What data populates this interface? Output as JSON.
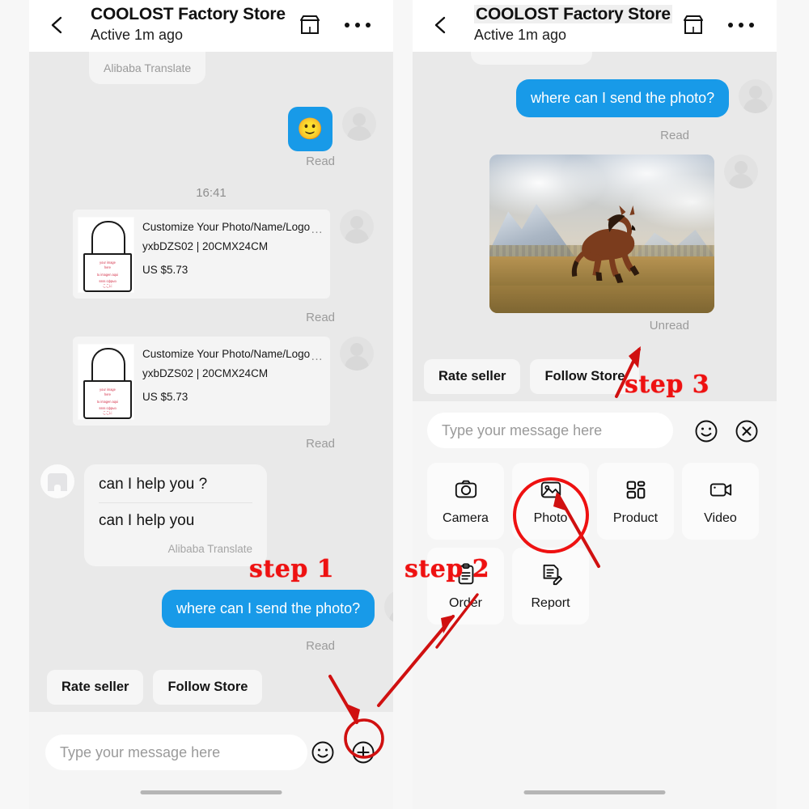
{
  "header": {
    "title": "COOLOST Factory Store",
    "subtitle": "Active 1m ago",
    "back_icon": "chevron-left-icon",
    "store_icon": "storefront-icon",
    "more_icon": "more-options-icon"
  },
  "left_panel": {
    "translate_chip": "Alibaba Translate",
    "emoji_message": "🙂",
    "emoji_status": "Read",
    "timestamp": "16:41",
    "product_cards": [
      {
        "title": "Customize Your Photo/Name/Logo",
        "variant": "yxbDZS02 | 20CMX24CM",
        "price": "US $5.73",
        "more": "…",
        "status": "Read",
        "bag_text_lines": [
          "your image",
          "here",
          "tu imagen aqui",
          "ssss сфрыз",
          "ここに"
        ]
      },
      {
        "title": "Customize Your Photo/Name/Logo",
        "variant": "yxbDZS02 | 20CMX24CM",
        "price": "US $5.73",
        "more": "…",
        "status": "Read",
        "bag_text_lines": [
          "your image",
          "here",
          "tu imagen aqui",
          "ssss сфрыз",
          "ここに"
        ]
      }
    ],
    "seller_message": {
      "line1": "can I help you ?",
      "line2": "can I help you",
      "translate_note": "Alibaba Translate"
    },
    "user_message": {
      "text": "where can I send the photo?",
      "status": "Read"
    },
    "chips": [
      "Rate seller",
      "Follow Store"
    ],
    "composer": {
      "placeholder": "Type your message here",
      "emoji_icon": "smiley-face-icon",
      "plus_icon": "plus-circle-icon"
    }
  },
  "right_panel": {
    "user_message": {
      "text": "where can I send the photo?",
      "status": "Read"
    },
    "photo_message": {
      "alt": "horse running in mountain landscape",
      "status": "Unread"
    },
    "chips": [
      "Rate seller",
      "Follow Store"
    ],
    "composer": {
      "placeholder": "Type your message here",
      "emoji_icon": "smiley-face-icon",
      "close_icon": "close-circle-icon"
    },
    "attachments": [
      {
        "label": "Camera",
        "icon": "camera-icon",
        "highlighted": false
      },
      {
        "label": "Photo",
        "icon": "image-icon",
        "highlighted": true
      },
      {
        "label": "Product",
        "icon": "product-icon",
        "highlighted": false
      },
      {
        "label": "Video",
        "icon": "video-icon",
        "highlighted": false
      },
      {
        "label": "Order",
        "icon": "clipboard-icon",
        "highlighted": false
      },
      {
        "label": "Report",
        "icon": "report-icon",
        "highlighted": false
      }
    ]
  },
  "annotations": {
    "step1": "step 1",
    "step2": "step 2",
    "step3": "step 3",
    "color": "#ee1111"
  },
  "colors": {
    "accent_blue": "#189ae8",
    "annotation_red": "#ee1111",
    "panel_bg": "#e9e9e9",
    "header_bg": "#ffffff"
  }
}
